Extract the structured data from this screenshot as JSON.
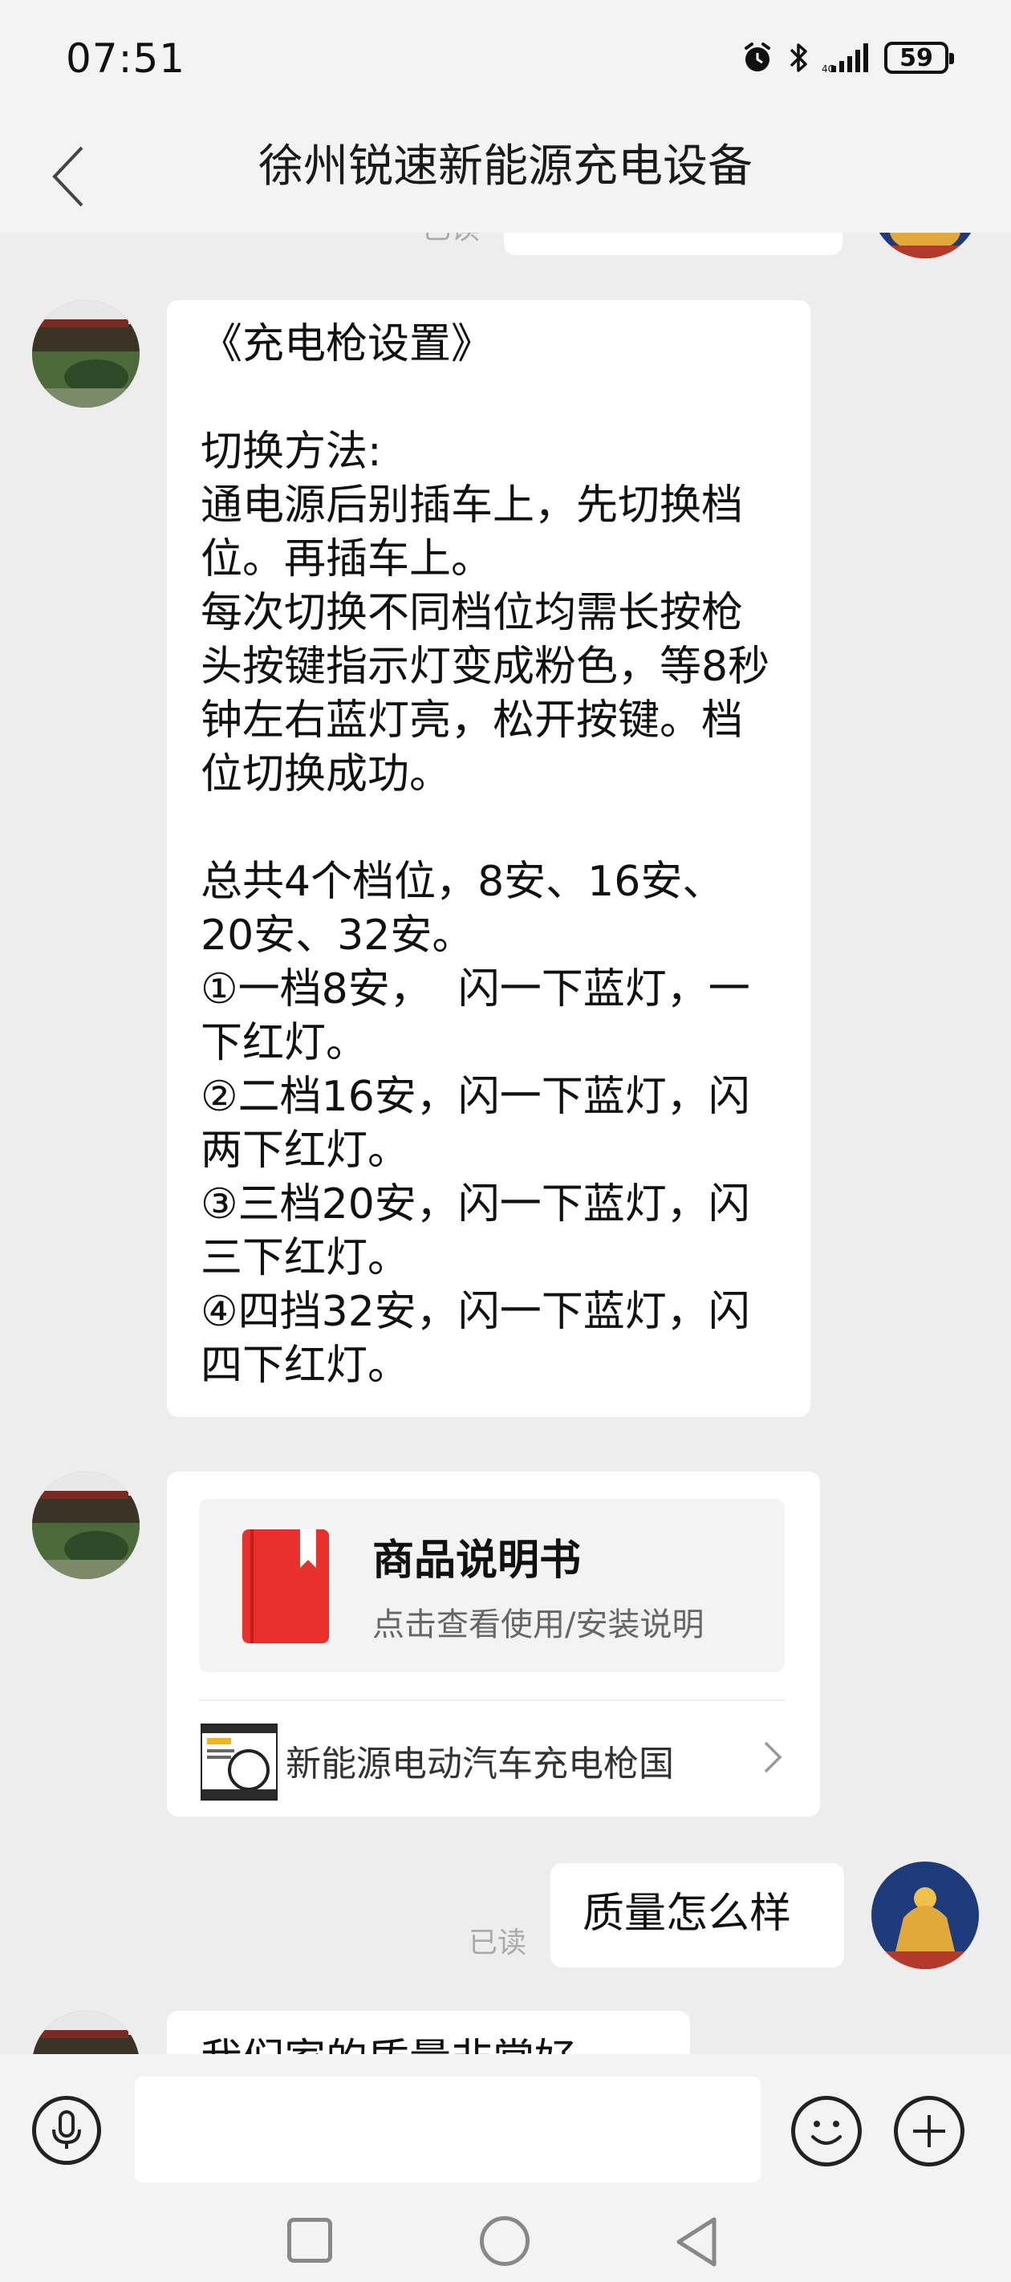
{
  "status_bar": {
    "time": "07:51",
    "icons": [
      "alarm-icon",
      "bluetooth-icon",
      "signal-icon"
    ],
    "battery_level": "59"
  },
  "header": {
    "back_icon": "chevron-left-icon",
    "title": "徐州锐速新能源充电设备"
  },
  "messages": [
    {
      "sender": "merchant",
      "text": "《充电枪设置》\n\n切换方法:\n通电源后别插车上，先切换档位。再插车上。\n每次切换不同档位均需长按枪头按键指示灯变成粉色，等8秒钟左右蓝灯亮，松开按键。档位切换成功。\n\n总共4个档位，8安、16安、20安、32安。\n①一档8安，  闪一下蓝灯，一下红灯。\n②二档16安，闪一下蓝灯，闪两下红灯。\n③三档20安，闪一下蓝灯，闪三下红灯。\n④四挡32安，闪一下蓝灯，闪四下红灯。"
    },
    {
      "sender": "merchant",
      "card": {
        "title": "商品说明书",
        "subtitle": "点击查看使用/安装说明",
        "product_name": "新能源电动汽车充电枪国",
        "icon": "book-icon"
      }
    },
    {
      "sender": "me",
      "text": "质量怎么样",
      "read_status": "已读"
    },
    {
      "sender": "merchant",
      "text": "我们家的质量非常好"
    }
  ],
  "top_partial": {
    "read_status": "已读"
  },
  "input_bar": {
    "placeholder": "",
    "voice_icon": "microphone-icon",
    "emoji_icon": "smiley-icon",
    "plus_icon": "plus-icon"
  },
  "nav_bar": {
    "icons": [
      "recent-apps-icon",
      "home-icon",
      "back-triangle-icon"
    ]
  }
}
